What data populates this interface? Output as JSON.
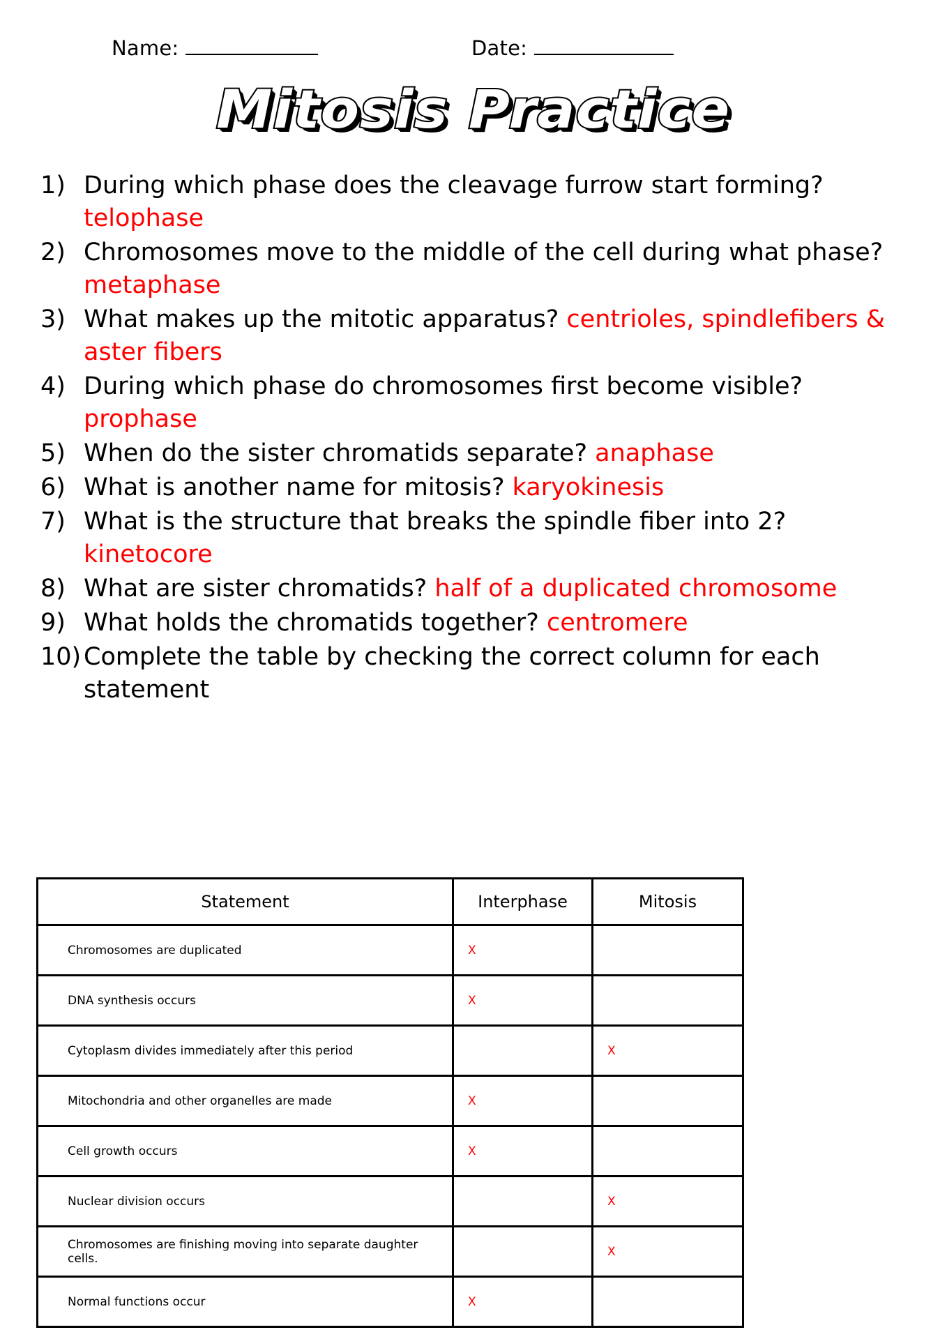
{
  "header": {
    "name_label": "Name:",
    "date_label": "Date:"
  },
  "title": "Mitosis Practice",
  "questions": [
    {
      "num": "1)",
      "text": "During which phase does the cleavage furrow start forming? ",
      "answer": "telophase"
    },
    {
      "num": "2)",
      "text": "Chromosomes move to the middle of the cell during what phase? ",
      "answer": "metaphase"
    },
    {
      "num": "3)",
      "text": "What makes up the mitotic apparatus? ",
      "answer": "centrioles, spindlefibers & aster fibers"
    },
    {
      "num": "4)",
      "text": "During which phase do chromosomes first become visible? ",
      "answer": "prophase"
    },
    {
      "num": "5)",
      "text": "When do the sister chromatids separate? ",
      "answer": "anaphase"
    },
    {
      "num": "6)",
      "text": "What is another name for mitosis? ",
      "answer": "karyokinesis"
    },
    {
      "num": "7)",
      "text": "What is the structure that breaks the spindle fiber into 2? ",
      "answer": "kinetocore"
    },
    {
      "num": "8)",
      "text": "What are sister chromatids? ",
      "answer": "half of a duplicated chromosome"
    },
    {
      "num": "9)",
      "text": "What holds the chromatids together? ",
      "answer": "centromere"
    },
    {
      "num": "10)",
      "text": "Complete the table by checking the correct column for each statement",
      "answer": ""
    }
  ],
  "table": {
    "columns": [
      "Statement",
      "Interphase",
      "Mitosis"
    ],
    "mark": "X",
    "rows": [
      {
        "statement": "Chromosomes are duplicated",
        "interphase": "X",
        "mitosis": ""
      },
      {
        "statement": "DNA synthesis occurs",
        "interphase": "X",
        "mitosis": ""
      },
      {
        "statement": "Cytoplasm divides immediately after this period",
        "interphase": "",
        "mitosis": "X"
      },
      {
        "statement": "Mitochondria and other organelles are made",
        "interphase": "X",
        "mitosis": ""
      },
      {
        "statement": "Cell growth occurs",
        "interphase": "X",
        "mitosis": ""
      },
      {
        "statement": "Nuclear division occurs",
        "interphase": "",
        "mitosis": "X"
      },
      {
        "statement": "Chromosomes are finishing moving into separate daughter cells.",
        "interphase": "",
        "mitosis": "X"
      },
      {
        "statement": "Normal functions occur",
        "interphase": "X",
        "mitosis": ""
      }
    ]
  },
  "colors": {
    "answer_red": "#ff0000",
    "text_black": "#000000",
    "page_background": "#ffffff"
  }
}
